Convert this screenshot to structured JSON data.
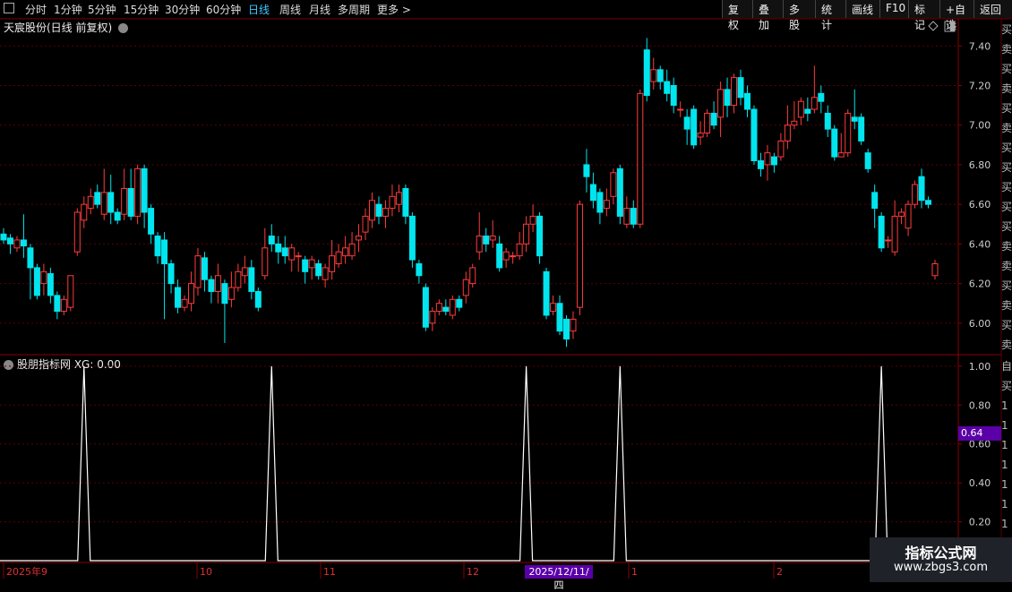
{
  "toolbar": {
    "tabs": [
      "分时",
      "1分钟",
      "5分钟",
      "15分钟",
      "30分钟",
      "60分钟",
      "日线",
      "周线",
      "月线",
      "多周期",
      "更多 >"
    ],
    "active_tab": "日线",
    "right_buttons": [
      "复权",
      "叠加",
      "多股",
      "统计",
      "画线",
      "F10",
      "标记",
      "+自选",
      "返回"
    ]
  },
  "main_chart": {
    "title": "天宸股份(日线 前复权)",
    "price_labels": [
      "7.40",
      "7.20",
      "7.00",
      "6.80",
      "6.60",
      "6.40",
      "6.20",
      "6.00"
    ]
  },
  "indicator": {
    "label": "股朋指标网 XG: 0.00",
    "y_labels": [
      "1.00",
      "0.80",
      "0.60",
      "0.40",
      "0.20"
    ],
    "current_value": "0.64"
  },
  "x_axis": {
    "labels": [
      "2025年9",
      "10",
      "11",
      "12",
      "1",
      "2"
    ],
    "highlight_date": "2025/12/11/四"
  },
  "side_panel_text": "买卖买卖买卖买买买买买卖卖买卖买卖买卖买卖买卖买卖",
  "side_panel_text2": "自买1111111",
  "watermark": {
    "title": "指标公式网",
    "url": "www.zbgs3.com"
  },
  "colors": {
    "up": "#ff3b3b",
    "down": "#00e5ee",
    "grid": "#5a0000",
    "active": "#3ec8ff",
    "badge": "#5b00a8"
  },
  "chart_data": [
    {
      "type": "candlestick",
      "y_range": [
        5.85,
        7.46
      ],
      "candles": [
        [
          6.45,
          6.42,
          6.48,
          6.4
        ],
        [
          6.43,
          6.4,
          6.45,
          6.35
        ],
        [
          6.38,
          6.42,
          6.44,
          6.36
        ],
        [
          6.42,
          6.39,
          6.55,
          6.33
        ],
        [
          6.38,
          6.28,
          6.4,
          6.12
        ],
        [
          6.28,
          6.14,
          6.3,
          6.12
        ],
        [
          6.2,
          6.26,
          6.3,
          6.14
        ],
        [
          6.25,
          6.14,
          6.28,
          6.1
        ],
        [
          6.14,
          6.06,
          6.16,
          6.02
        ],
        [
          6.06,
          6.12,
          6.14,
          6.04
        ],
        [
          6.08,
          6.24,
          6.24,
          6.06
        ],
        [
          6.36,
          6.56,
          6.58,
          6.34
        ],
        [
          6.52,
          6.6,
          6.64,
          6.48
        ],
        [
          6.58,
          6.64,
          6.68,
          6.55
        ],
        [
          6.66,
          6.6,
          6.7,
          6.58
        ],
        [
          6.55,
          6.66,
          6.78,
          6.52
        ],
        [
          6.66,
          6.56,
          6.75,
          6.5
        ],
        [
          6.56,
          6.52,
          6.58,
          6.5
        ],
        [
          6.55,
          6.68,
          6.78,
          6.52
        ],
        [
          6.68,
          6.54,
          6.78,
          6.52
        ],
        [
          6.54,
          6.78,
          6.8,
          6.5
        ],
        [
          6.78,
          6.56,
          6.8,
          6.48
        ],
        [
          6.58,
          6.45,
          6.6,
          6.4
        ],
        [
          6.44,
          6.34,
          6.46,
          6.3
        ],
        [
          6.42,
          6.3,
          6.46,
          6.02
        ],
        [
          6.3,
          6.2,
          6.32,
          6.15
        ],
        [
          6.18,
          6.08,
          6.22,
          6.05
        ],
        [
          6.08,
          6.12,
          6.14,
          6.06
        ],
        [
          6.1,
          6.2,
          6.26,
          6.06
        ],
        [
          6.18,
          6.34,
          6.38,
          6.14
        ],
        [
          6.33,
          6.22,
          6.36,
          6.16
        ],
        [
          6.22,
          6.16,
          6.24,
          6.1
        ],
        [
          6.16,
          6.24,
          6.3,
          6.1
        ],
        [
          6.2,
          6.1,
          6.22,
          5.9
        ],
        [
          6.12,
          6.18,
          6.26,
          6.08
        ],
        [
          6.18,
          6.26,
          6.3,
          6.16
        ],
        [
          6.24,
          6.28,
          6.34,
          6.2
        ],
        [
          6.28,
          6.16,
          6.32,
          6.12
        ],
        [
          6.16,
          6.08,
          6.18,
          6.06
        ],
        [
          6.24,
          6.38,
          6.48,
          6.22
        ],
        [
          6.44,
          6.4,
          6.5,
          6.36
        ],
        [
          6.4,
          6.36,
          6.44,
          6.3
        ],
        [
          6.38,
          6.34,
          6.44,
          6.3
        ],
        [
          6.32,
          6.38,
          6.4,
          6.26
        ],
        [
          6.34,
          6.34,
          6.36,
          6.26
        ],
        [
          6.32,
          6.26,
          6.34,
          6.2
        ],
        [
          6.28,
          6.32,
          6.34,
          6.22
        ],
        [
          6.3,
          6.24,
          6.32,
          6.22
        ],
        [
          6.22,
          6.28,
          6.3,
          6.18
        ],
        [
          6.26,
          6.34,
          6.42,
          6.22
        ],
        [
          6.3,
          6.36,
          6.4,
          6.28
        ],
        [
          6.34,
          6.38,
          6.44,
          6.3
        ],
        [
          6.34,
          6.4,
          6.46,
          6.32
        ],
        [
          6.42,
          6.44,
          6.5,
          6.36
        ],
        [
          6.46,
          6.54,
          6.58,
          6.42
        ],
        [
          6.52,
          6.62,
          6.66,
          6.48
        ],
        [
          6.6,
          6.54,
          6.64,
          6.5
        ],
        [
          6.54,
          6.58,
          6.62,
          6.48
        ],
        [
          6.58,
          6.64,
          6.7,
          6.54
        ],
        [
          6.6,
          6.66,
          6.7,
          6.56
        ],
        [
          6.68,
          6.54,
          6.7,
          6.5
        ],
        [
          6.54,
          6.32,
          6.56,
          6.28
        ],
        [
          6.3,
          6.24,
          6.32,
          6.2
        ],
        [
          6.18,
          5.98,
          6.2,
          5.96
        ],
        [
          6.0,
          6.06,
          6.08,
          5.96
        ],
        [
          6.06,
          6.1,
          6.12,
          6.04
        ],
        [
          6.08,
          6.06,
          6.12,
          6.04
        ],
        [
          6.04,
          6.12,
          6.14,
          6.02
        ],
        [
          6.12,
          6.08,
          6.14,
          6.06
        ],
        [
          6.14,
          6.22,
          6.26,
          6.1
        ],
        [
          6.2,
          6.28,
          6.3,
          6.18
        ],
        [
          6.36,
          6.44,
          6.56,
          6.32
        ],
        [
          6.44,
          6.4,
          6.48,
          6.36
        ],
        [
          6.42,
          6.44,
          6.52,
          6.38
        ],
        [
          6.4,
          6.28,
          6.44,
          6.26
        ],
        [
          6.32,
          6.36,
          6.38,
          6.28
        ],
        [
          6.34,
          6.34,
          6.36,
          6.3
        ],
        [
          6.34,
          6.4,
          6.46,
          6.32
        ],
        [
          6.4,
          6.5,
          6.54,
          6.36
        ],
        [
          6.5,
          6.54,
          6.6,
          6.46
        ],
        [
          6.54,
          6.34,
          6.56,
          6.3
        ],
        [
          6.26,
          6.04,
          6.28,
          6.02
        ],
        [
          6.06,
          6.1,
          6.14,
          6.04
        ],
        [
          6.1,
          5.96,
          6.14,
          5.94
        ],
        [
          6.02,
          5.92,
          6.04,
          5.88
        ],
        [
          5.96,
          6.02,
          6.06,
          5.92
        ],
        [
          6.08,
          6.6,
          6.62,
          6.04
        ],
        [
          6.8,
          6.74,
          6.88,
          6.66
        ],
        [
          6.7,
          6.62,
          6.76,
          6.58
        ],
        [
          6.66,
          6.56,
          6.68,
          6.5
        ],
        [
          6.58,
          6.62,
          6.68,
          6.54
        ],
        [
          6.64,
          6.76,
          6.78,
          6.6
        ],
        [
          6.78,
          6.54,
          6.8,
          6.5
        ],
        [
          6.5,
          6.58,
          6.64,
          6.48
        ],
        [
          6.58,
          6.5,
          6.62,
          6.48
        ],
        [
          6.5,
          7.16,
          7.18,
          6.48
        ],
        [
          7.38,
          7.15,
          7.44,
          7.12
        ],
        [
          7.22,
          7.28,
          7.34,
          7.18
        ],
        [
          7.28,
          7.22,
          7.3,
          7.18
        ],
        [
          7.22,
          7.16,
          7.28,
          7.12
        ],
        [
          7.2,
          7.1,
          7.24,
          7.06
        ],
        [
          7.08,
          7.08,
          7.12,
          7.04
        ],
        [
          7.04,
          6.98,
          7.08,
          6.9
        ],
        [
          7.08,
          6.9,
          7.1,
          6.88
        ],
        [
          6.94,
          6.96,
          7.02,
          6.9
        ],
        [
          6.96,
          7.06,
          7.08,
          6.94
        ],
        [
          7.06,
          7.0,
          7.12,
          6.98
        ],
        [
          7.04,
          7.18,
          7.22,
          6.94
        ],
        [
          7.18,
          7.1,
          7.24,
          7.04
        ],
        [
          7.1,
          7.24,
          7.26,
          7.06
        ],
        [
          7.24,
          7.14,
          7.28,
          7.1
        ],
        [
          7.16,
          7.08,
          7.2,
          7.04
        ],
        [
          7.08,
          6.82,
          7.1,
          6.8
        ],
        [
          6.82,
          6.78,
          6.86,
          6.74
        ],
        [
          6.8,
          6.86,
          6.9,
          6.72
        ],
        [
          6.84,
          6.8,
          6.86,
          6.76
        ],
        [
          6.84,
          6.92,
          6.96,
          6.82
        ],
        [
          6.92,
          7.0,
          7.1,
          6.88
        ],
        [
          7.0,
          7.02,
          7.12,
          6.98
        ],
        [
          7.04,
          7.12,
          7.14,
          7.0
        ],
        [
          7.08,
          7.06,
          7.14,
          7.02
        ],
        [
          7.08,
          7.14,
          7.3,
          7.06
        ],
        [
          7.16,
          7.12,
          7.2,
          7.06
        ],
        [
          7.06,
          6.98,
          7.1,
          6.94
        ],
        [
          6.98,
          6.84,
          7.0,
          6.82
        ],
        [
          6.84,
          6.86,
          6.96,
          6.84
        ],
        [
          6.86,
          7.06,
          7.08,
          6.84
        ],
        [
          7.04,
          7.02,
          7.18,
          6.98
        ],
        [
          7.04,
          6.92,
          7.06,
          6.9
        ],
        [
          6.86,
          6.78,
          6.88,
          6.76
        ],
        [
          6.66,
          6.58,
          6.7,
          6.48
        ],
        [
          6.54,
          6.38,
          6.56,
          6.36
        ],
        [
          6.42,
          6.42,
          6.44,
          6.38
        ],
        [
          6.36,
          6.54,
          6.62,
          6.34
        ],
        [
          6.54,
          6.56,
          6.58,
          6.5
        ],
        [
          6.48,
          6.6,
          6.62,
          6.44
        ],
        [
          6.6,
          6.7,
          6.72,
          6.58
        ],
        [
          6.74,
          6.62,
          6.78,
          6.58
        ],
        [
          6.62,
          6.6,
          6.64,
          6.58
        ],
        [
          6.24,
          6.3,
          6.32,
          6.22
        ]
      ]
    },
    {
      "type": "line",
      "series": [
        {
          "name": "XG",
          "spikes_at_index": [
            12,
            40,
            78,
            92,
            131
          ]
        }
      ],
      "ylim": [
        0,
        1.05
      ]
    }
  ]
}
